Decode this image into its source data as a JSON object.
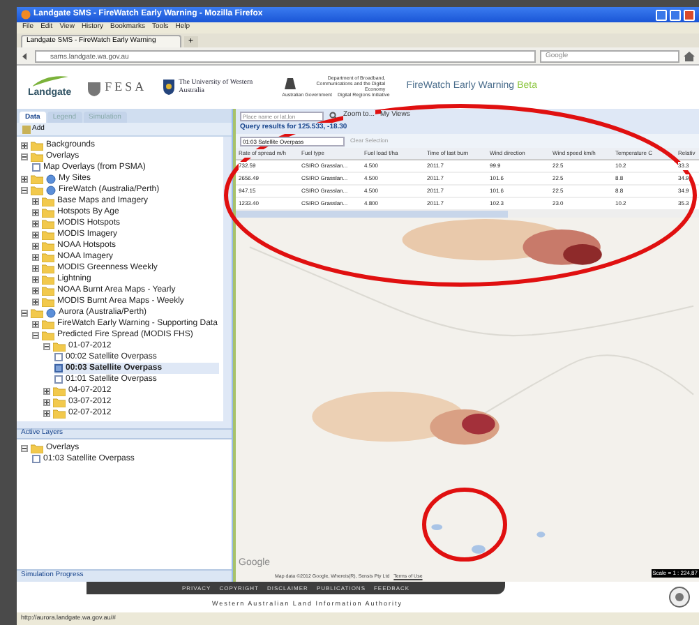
{
  "window": {
    "title": "Landgate SMS - FireWatch Early Warning - Mozilla Firefox"
  },
  "menu": [
    "File",
    "Edit",
    "View",
    "History",
    "Bookmarks",
    "Tools",
    "Help"
  ],
  "browser_tab": {
    "title": "Landgate SMS - FireWatch Early Warning",
    "new_tab": "+"
  },
  "address_bar": {
    "url": "sams.landgate.wa.gov.au"
  },
  "search_field": {
    "placeholder": "Google"
  },
  "banner": {
    "landgate": "Landgate",
    "fesa": "FESA",
    "uwa": "The University of Western Australia",
    "dept": "Department of Broadband, Communications and the Digital Economy",
    "gov": "Australian Government",
    "dri": "Digital Regions Initiative",
    "app_title": "FireWatch Early Warning",
    "badge": "Beta"
  },
  "panel_tabs": [
    {
      "label": "Data",
      "selected": true
    },
    {
      "label": "Legend",
      "selected": false
    },
    {
      "label": "Simulation",
      "selected": false
    }
  ],
  "add_button": "Add",
  "layer_tree": [
    {
      "kind": "folder",
      "label": "Backgrounds",
      "expanded": false
    },
    {
      "kind": "folder",
      "label": "Overlays",
      "expanded": true,
      "children": [
        {
          "kind": "layer",
          "label": "Map Overlays (from PSMA)",
          "checked": false,
          "selected": false
        }
      ]
    },
    {
      "kind": "service",
      "label": "My Sites",
      "expanded": false
    },
    {
      "kind": "service",
      "label": "FireWatch (Australia/Perth)",
      "expanded": true,
      "children": [
        {
          "kind": "folder",
          "label": "Base Maps and Imagery",
          "expanded": false
        },
        {
          "kind": "folder",
          "label": "Hotspots By Age",
          "expanded": false
        },
        {
          "kind": "folder",
          "label": "MODIS Hotspots",
          "expanded": false
        },
        {
          "kind": "folder",
          "label": "MODIS Imagery",
          "expanded": false
        },
        {
          "kind": "folder",
          "label": "NOAA Hotspots",
          "expanded": false
        },
        {
          "kind": "folder",
          "label": "NOAA Imagery",
          "expanded": false
        },
        {
          "kind": "folder",
          "label": "MODIS Greenness Weekly",
          "expanded": false
        },
        {
          "kind": "folder",
          "label": "Lightning",
          "expanded": false
        },
        {
          "kind": "folder",
          "label": "NOAA Burnt Area Maps - Yearly",
          "expanded": false
        },
        {
          "kind": "folder",
          "label": "MODIS Burnt Area Maps - Weekly",
          "expanded": false
        }
      ]
    },
    {
      "kind": "service",
      "label": "Aurora (Australia/Perth)",
      "expanded": true,
      "children": [
        {
          "kind": "folder",
          "label": "FireWatch Early Warning - Supporting Data",
          "expanded": false
        },
        {
          "kind": "folder",
          "label": "Predicted Fire Spread (MODIS FHS)",
          "expanded": true,
          "children": [
            {
              "kind": "folder",
              "label": "01-07-2012",
              "expanded": true,
              "children": [
                {
                  "kind": "layer",
                  "label": "00:02 Satellite Overpass",
                  "checked": false,
                  "selected": false
                },
                {
                  "kind": "layer",
                  "label": "00:03 Satellite Overpass",
                  "checked": true,
                  "selected": true
                },
                {
                  "kind": "layer",
                  "label": "01:01 Satellite Overpass",
                  "checked": false,
                  "selected": false
                }
              ]
            },
            {
              "kind": "folder",
              "label": "04-07-2012",
              "expanded": false
            },
            {
              "kind": "folder",
              "label": "03-07-2012",
              "expanded": false
            },
            {
              "kind": "folder",
              "label": "02-07-2012",
              "expanded": false
            }
          ]
        }
      ]
    }
  ],
  "active_layers": {
    "title": "Active Layers",
    "tree": [
      {
        "kind": "folder",
        "label": "Overlays",
        "expanded": true,
        "children": [
          {
            "kind": "layer",
            "label": "01:03 Satellite Overpass",
            "checked": false,
            "selected": false
          }
        ]
      }
    ]
  },
  "simulation_progress": {
    "title": "Simulation Progress"
  },
  "map_toolbar": {
    "place_placeholder": "Place name or lat,lon",
    "zoom_button": "Zoom to...",
    "views_button": "My Views"
  },
  "query": {
    "title": "Query results for 125.533, -18.30",
    "layer_select": "01:03 Satellite Overpass",
    "clear_button": "Clear Selection",
    "columns": [
      "Rate of spread m/h",
      "Fuel type",
      "Fuel load t/ha",
      "Time of last burn",
      "Wind direction",
      "Wind speed km/h",
      "Temperature C",
      "Relativ"
    ],
    "rows": [
      [
        "732.59",
        "CSIRO Grasslan...",
        "4.500",
        "2011.7",
        "99.9",
        "22.5",
        "10.2",
        "33.3"
      ],
      [
        "2656.49",
        "CSIRO Grasslan...",
        "4.500",
        "2011.7",
        "101.6",
        "22.5",
        "8.8",
        "34.9"
      ],
      [
        "947.15",
        "CSIRO Grasslan...",
        "4.500",
        "2011.7",
        "101.6",
        "22.5",
        "8.8",
        "34.9"
      ],
      [
        "1233.40",
        "CSIRO Grasslan...",
        "4.800",
        "2011.7",
        "102.3",
        "23.0",
        "10.2",
        "35.3"
      ]
    ]
  },
  "map": {
    "google": "Google",
    "attribution": "Map data ©2012 Google, Whereis(R), Sensis Pty Ltd",
    "terms": "Terms of Use",
    "scale": "Scale = 1 : 224,87"
  },
  "footer": {
    "links": [
      "PRIVACY",
      "COPYRIGHT",
      "DISCLAIMER",
      "PUBLICATIONS",
      "FEEDBACK"
    ],
    "authority": "Western Australian Land Information Authority"
  },
  "status_bar": {
    "url": "http://aurora.landgate.wa.gov.au/#"
  }
}
